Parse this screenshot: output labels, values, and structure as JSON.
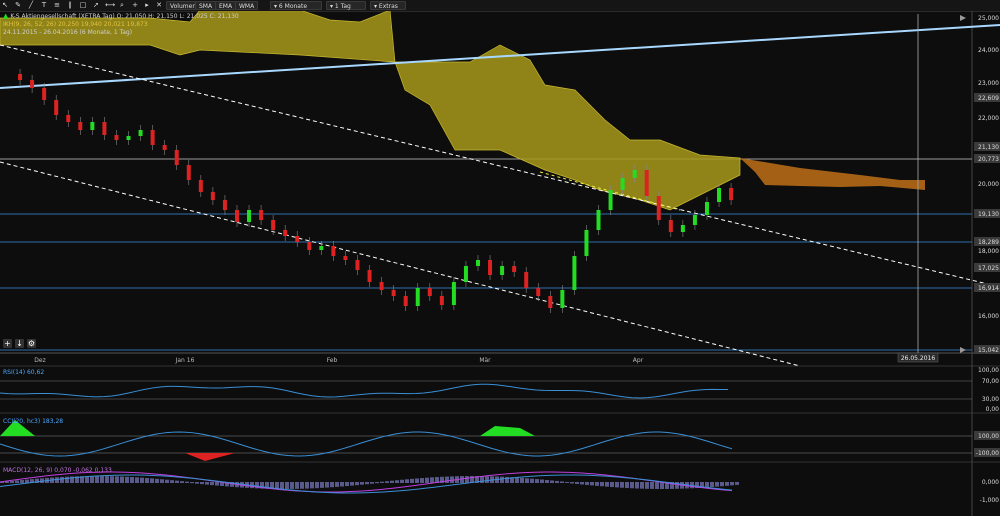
{
  "toolbar": {
    "buttons": [
      "Volumen",
      "SMA",
      "EMA",
      "WMA"
    ],
    "period": "6 Monate",
    "interval": "1 Tag",
    "extras": "Extras"
  },
  "legend": {
    "main": "K-S Aktiengesellschaft (XETRA Tag) O: 21,050 H: 21,150 L: 21,025 C: 21,130",
    "ikh": "IKH(9, 26, 52, 26) 20,250 19,940 20,021 19,873",
    "period": "24.11.2015 - 26.04.2016 (6 Monate, 1 Tag)"
  },
  "x_labels": [
    "Dez",
    "Jan 16",
    "Feb",
    "Mär",
    "Apr"
  ],
  "price_axis": [
    "25,000",
    "24,000",
    "23,000",
    "22,609",
    "22,000",
    "21,130",
    "20,773",
    "20,000",
    "19,130",
    "18,289",
    "18,000",
    "17,025",
    "16,914",
    "16,000",
    "15,042"
  ],
  "cursor_date": "26.05.2016",
  "rsi": {
    "label": "RSI(14) 60,62",
    "axis": [
      "100,00",
      "70,00",
      "30,00",
      "0,00"
    ]
  },
  "cci": {
    "label": "CCI(20, hc3) 183,28",
    "axis": [
      "100,00",
      "-100,00"
    ]
  },
  "macd": {
    "label": "MACD(12, 26, 9) 0,070 -0,062 0,133",
    "axis": [
      "0,000",
      "-1,000"
    ]
  },
  "colors": {
    "up": "#22dd22",
    "down": "#dd2222",
    "cloud": "#a89a1c",
    "cloud_future": "#c07018",
    "trend": "#a8d8ff",
    "rsi": "#3a8fd6"
  },
  "icons": [
    "add-icon",
    "download-icon",
    "settings-icon"
  ]
}
